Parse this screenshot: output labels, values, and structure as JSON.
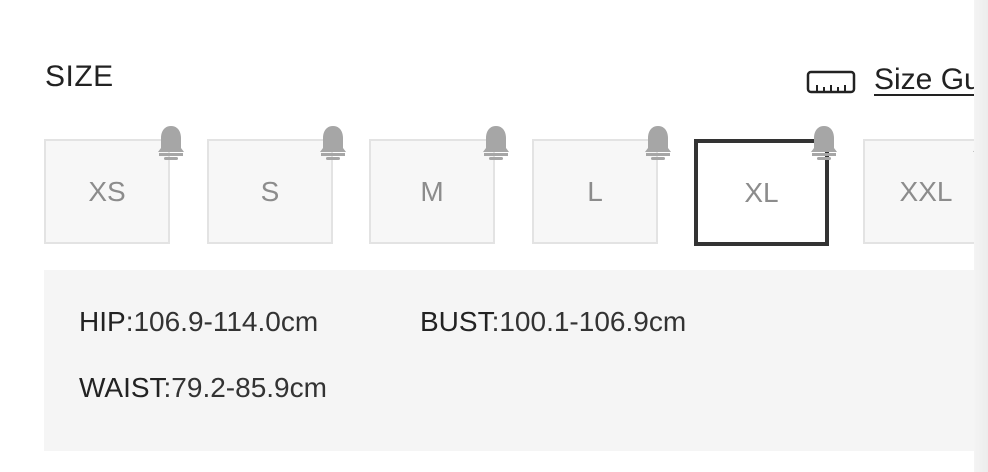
{
  "size_section": {
    "label": "SIZE",
    "guide_label": "Size Gu",
    "selected": "XL",
    "options": [
      {
        "label": "XS"
      },
      {
        "label": "S"
      },
      {
        "label": "M"
      },
      {
        "label": "L"
      },
      {
        "label": "XL"
      },
      {
        "label": "XXL"
      }
    ]
  },
  "measurements": {
    "hip": {
      "label": "HIP",
      "value": ":106.9-114.0cm"
    },
    "bust": {
      "label": "BUST",
      "value": ":100.1-106.9cm"
    },
    "waist": {
      "label": "WAIST",
      "value": ":79.2-85.9cm"
    }
  },
  "icons": {
    "notify": "bell-icon",
    "guide": "ruler-icon"
  },
  "colors": {
    "selected_border": "#333333",
    "option_border": "#e3e3e3",
    "option_bg": "#f7f7f7",
    "option_text": "#8c8c8c",
    "bell": "#a6a6a6",
    "info_bg": "#f5f5f5"
  }
}
